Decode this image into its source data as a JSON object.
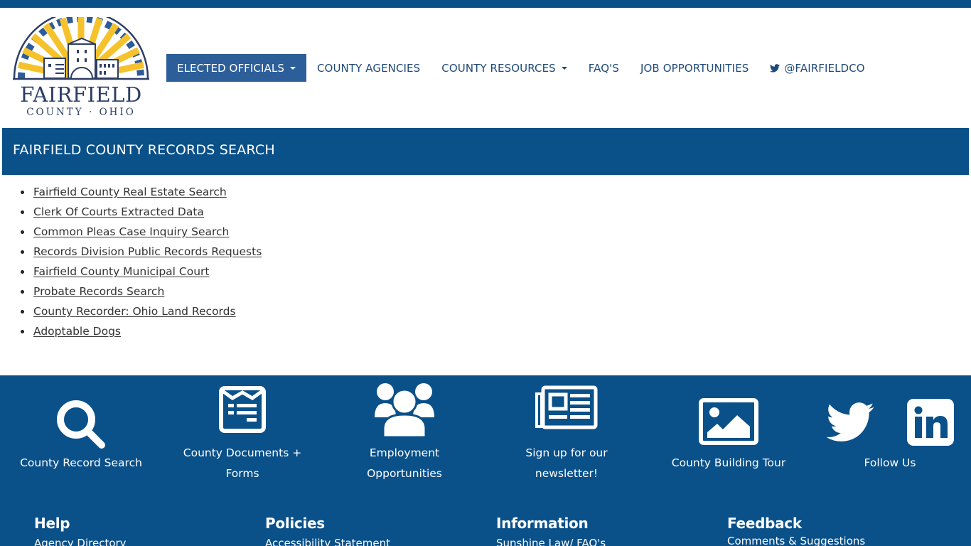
{
  "colors": {
    "brand_blue": "#0a5089",
    "nav_active": "#2c5e99",
    "logo_navy": "#2d3e66",
    "logo_gold": "#f5c22b"
  },
  "logo": {
    "title": "FAIRFIELD",
    "subtitle": "COUNTY · OHIO"
  },
  "nav": {
    "items": [
      {
        "label": "ELECTED OFFICIALS",
        "dropdown": true,
        "active": true
      },
      {
        "label": "COUNTY AGENCIES",
        "dropdown": false
      },
      {
        "label": "COUNTY RESOURCES",
        "dropdown": true
      },
      {
        "label": "FAQ'S",
        "dropdown": false
      },
      {
        "label": "JOB OPPORTUNITIES",
        "dropdown": false
      },
      {
        "label": "@FAIRFIELDCO",
        "icon": "twitter-icon"
      }
    ]
  },
  "banner": {
    "title": "FAIRFIELD COUNTY RECORDS SEARCH"
  },
  "links": [
    "Fairfield County Real Estate Search",
    "Clerk Of Courts Extracted Data",
    "Common Pleas Case Inquiry Search",
    "Records Division Public Records Requests",
    "Fairfield County Municipal Court",
    "Probate Records Search",
    "County Recorder: Ohio Land Records",
    "Adoptable Dogs"
  ],
  "tiles": [
    {
      "label": "County Record Search",
      "icon": "search-icon"
    },
    {
      "label_line1": "County Documents +",
      "label_line2": "Forms",
      "icon": "document-icon"
    },
    {
      "label_line1": "Employment",
      "label_line2": "Opportunities",
      "icon": "users-icon"
    },
    {
      "label_line1": "Sign up for our",
      "label_line2": "newsletter!",
      "icon": "newspaper-icon"
    },
    {
      "label": "County Building Tour",
      "icon": "image-icon"
    },
    {
      "label": "Follow Us",
      "icons": [
        "twitter-icon",
        "linkedin-icon"
      ]
    }
  ],
  "footer_columns": [
    {
      "heading": "Help",
      "links": [
        "Agency Directory"
      ]
    },
    {
      "heading": "Policies",
      "links": [
        "Accessibility Statement"
      ]
    },
    {
      "heading": "Information",
      "links": [
        "Sunshine Law/ FAQ's"
      ]
    },
    {
      "heading": "Feedback",
      "links": [
        "Comments & Suggestions"
      ]
    }
  ]
}
